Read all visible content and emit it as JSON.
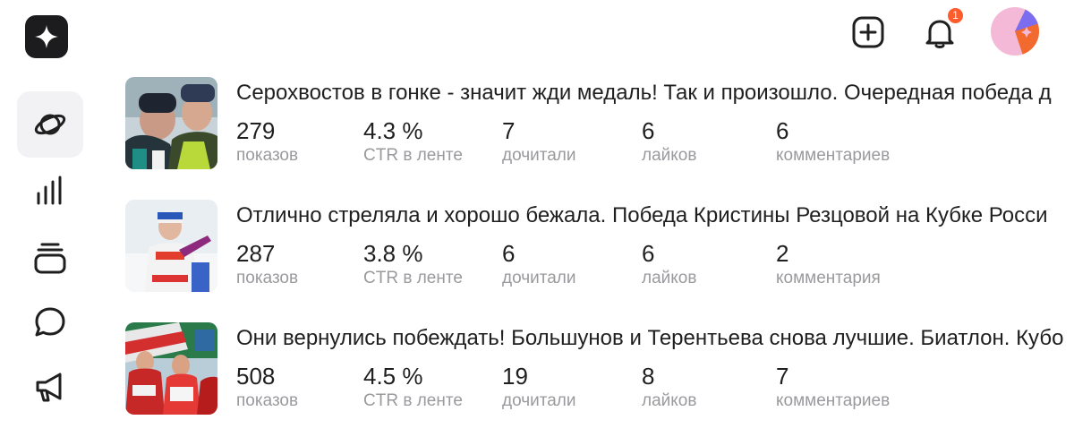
{
  "header": {
    "logo_icon": "sparkle-star-icon",
    "add_icon": "plus-square-icon",
    "bell_icon": "bell-icon",
    "notifications_count": "1",
    "badge_color": "#ff5c2e"
  },
  "sidebar": {
    "items": [
      {
        "icon": "planet-icon",
        "active": true
      },
      {
        "icon": "bar-chart-icon",
        "active": false
      },
      {
        "icon": "stack-layers-icon",
        "active": false
      },
      {
        "icon": "chat-bubble-icon",
        "active": false
      },
      {
        "icon": "megaphone-icon",
        "active": false
      }
    ]
  },
  "publications": [
    {
      "title": "Серохвостов в гонке - значит жди медаль! Так и произошло. Очередная победа д",
      "metrics": [
        {
          "value": "279",
          "label": "показов"
        },
        {
          "value": "4.3 %",
          "label": "CTR в ленте"
        },
        {
          "value": "7",
          "label": "дочитали"
        },
        {
          "value": "6",
          "label": "лайков"
        },
        {
          "value": "6",
          "label": "комментариев"
        }
      ]
    },
    {
      "title": "Отлично стреляла и хорошо бежала. Победа Кристины Резцовой на Кубке Росси",
      "metrics": [
        {
          "value": "287",
          "label": "показов"
        },
        {
          "value": "3.8 %",
          "label": "CTR в ленте"
        },
        {
          "value": "6",
          "label": "дочитали"
        },
        {
          "value": "6",
          "label": "лайков"
        },
        {
          "value": "2",
          "label": "комментария"
        }
      ]
    },
    {
      "title": "Они вернулись побеждать! Большунов и Терентьева снова лучшие. Биатлон. Кубо",
      "metrics": [
        {
          "value": "508",
          "label": "показов"
        },
        {
          "value": "4.5 %",
          "label": "CTR в ленте"
        },
        {
          "value": "19",
          "label": "дочитали"
        },
        {
          "value": "8",
          "label": "лайков"
        },
        {
          "value": "7",
          "label": "комментариев"
        }
      ]
    }
  ]
}
